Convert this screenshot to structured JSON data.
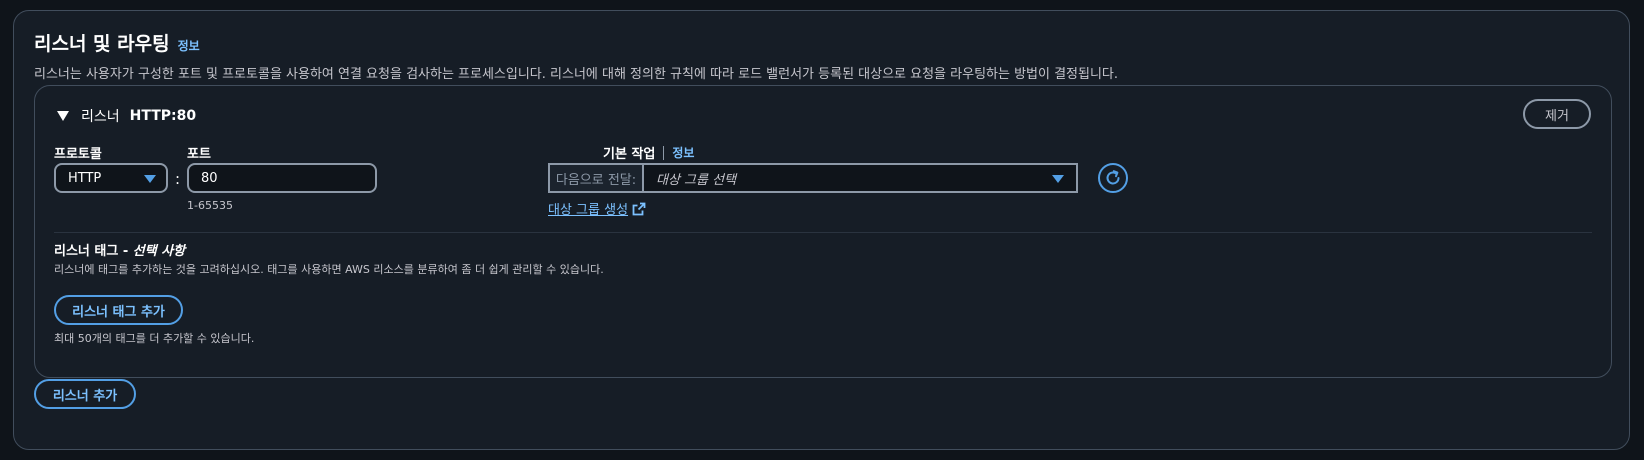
{
  "section": {
    "title": "리스너 및 라우팅",
    "info_label": "정보",
    "description": "리스너는 사용자가 구성한 포트 및 프로토콜을 사용하여 연결 요청을 검사하는 프로세스입니다. 리스너에 대해 정의한 규칙에 따라 로드 밸런서가 등록된 대상으로 요청을 라우팅하는 방법이 결정됩니다."
  },
  "listener": {
    "header_label": "리스너",
    "header_value": "HTTP:80",
    "remove_label": "제거",
    "protocol": {
      "label": "프로토콜",
      "value": "HTTP"
    },
    "colon": ":",
    "port": {
      "label": "포트",
      "value": "80",
      "hint": "1-65535"
    },
    "default_action": {
      "label": "기본 작업",
      "info_label": "정보",
      "prefix": "다음으로 전달:",
      "placeholder": "대상 그룹 선택",
      "create_link": "대상 그룹 생성"
    },
    "tags": {
      "title": "리스너 태그 - ",
      "title_optional": "선택 사항",
      "description": "리스너에 태그를 추가하는 것을 고려하십시오. 태그를 사용하면 AWS 리소스를 분류하여 좀 더 쉽게 관리할 수 있습니다.",
      "add_button": "리스너 태그 추가",
      "limit_text": "최대 50개의 태그를 더 추가할 수 있습니다."
    }
  },
  "add_listener_button": "리스너 추가",
  "icons": {
    "caret": "caret-down-icon",
    "dropdown": "chevron-down-icon",
    "refresh": "refresh-icon",
    "external": "external-link-icon"
  },
  "colors": {
    "background": "#0f141a",
    "panel": "#161d26",
    "accent": "#539fe5",
    "link": "#7cc1ff",
    "border": "#8d99a8"
  }
}
